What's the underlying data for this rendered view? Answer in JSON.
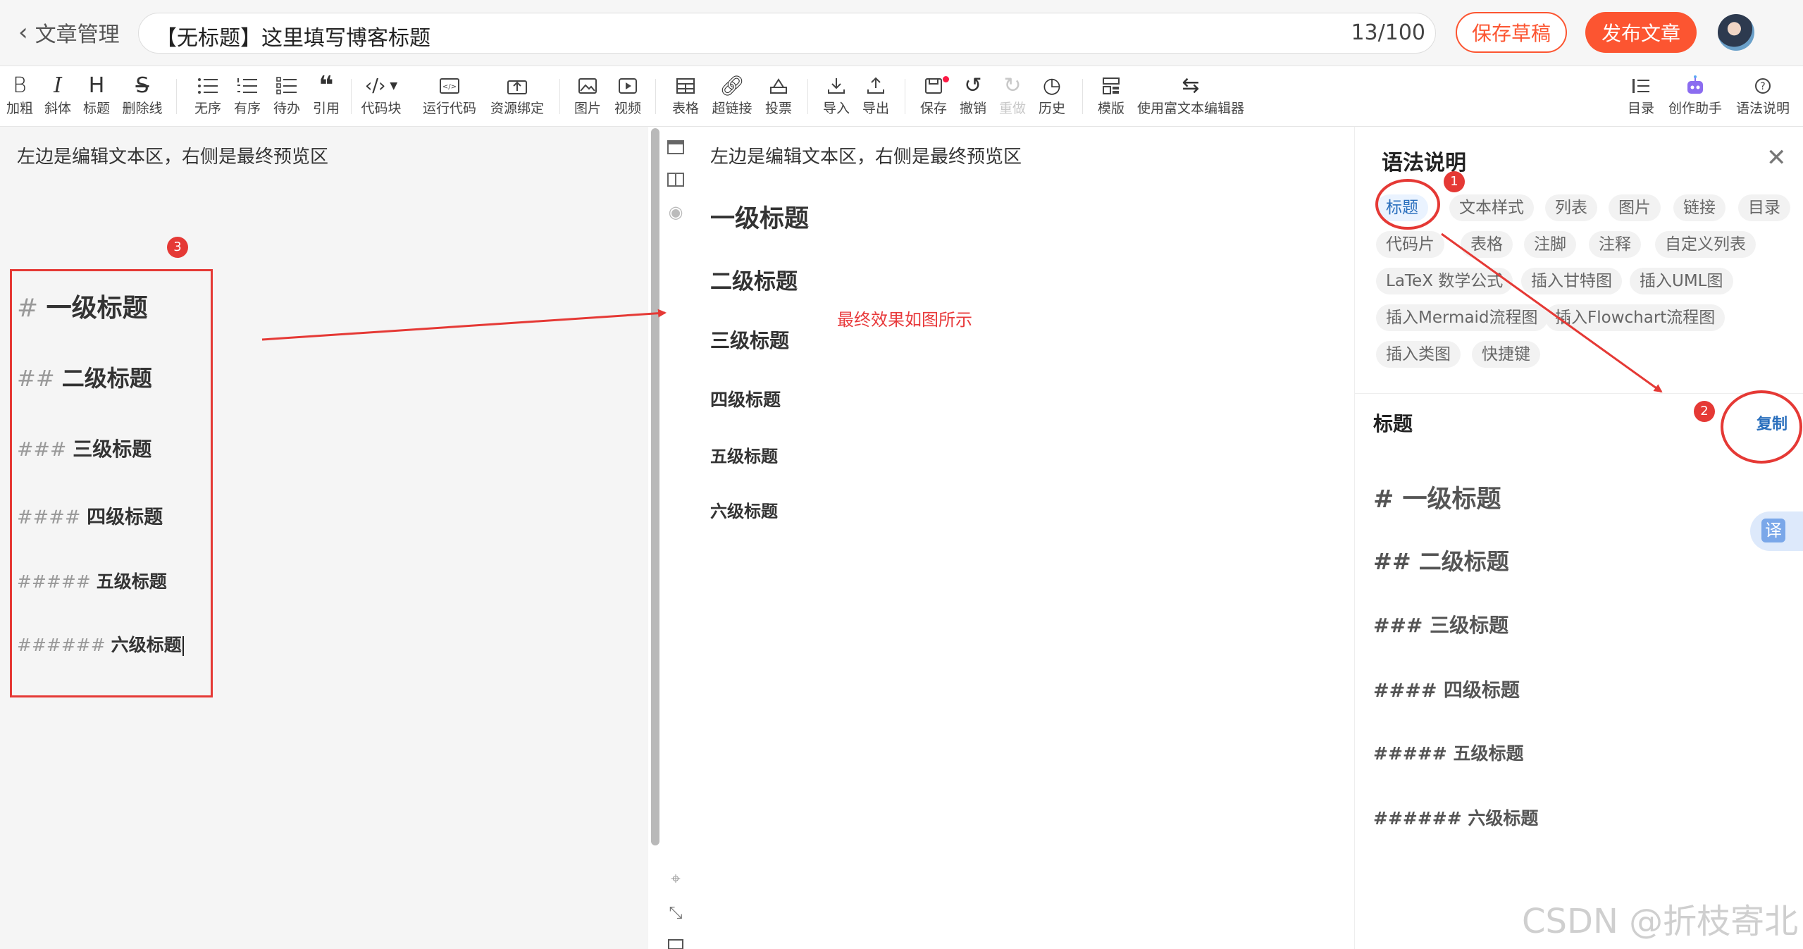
{
  "header": {
    "back_label": "文章管理",
    "title_value": "【无标题】这里填写博客标题",
    "title_count": "13/100",
    "save_draft": "保存草稿",
    "publish": "发布文章"
  },
  "toolbar": {
    "bold": "加粗",
    "italic": "斜体",
    "heading": "标题",
    "strike": "删除线",
    "ul": "无序",
    "ol": "有序",
    "todo": "待办",
    "quote": "引用",
    "codeblock": "代码块",
    "runcode": "运行代码",
    "resource": "资源绑定",
    "image": "图片",
    "video": "视频",
    "table": "表格",
    "link": "超链接",
    "vote": "投票",
    "import": "导入",
    "export": "导出",
    "save": "保存",
    "undo": "撤销",
    "redo": "重做",
    "history": "历史",
    "template": "模版",
    "richtext": "使用富文本编辑器",
    "toc": "目录",
    "assistant": "创作助手",
    "syntax": "语法说明"
  },
  "editor": {
    "intro": "左边是编辑文本区，右侧是最终预览区",
    "lines": [
      {
        "hash": "#",
        "text": "一级标题"
      },
      {
        "hash": "##",
        "text": "二级标题"
      },
      {
        "hash": "###",
        "text": "三级标题"
      },
      {
        "hash": "####",
        "text": "四级标题"
      },
      {
        "hash": "#####",
        "text": "五级标题"
      },
      {
        "hash": "######",
        "text": "六级标题"
      }
    ]
  },
  "preview": {
    "intro": "左边是编辑文本区，右侧是最终预览区",
    "headings": [
      "一级标题",
      "二级标题",
      "三级标题",
      "四级标题",
      "五级标题",
      "六级标题"
    ],
    "annotation": "最终效果如图所示"
  },
  "panel": {
    "title": "语法说明",
    "chips": [
      "标题",
      "文本样式",
      "列表",
      "图片",
      "链接",
      "目录",
      "代码片",
      "表格",
      "注脚",
      "注释",
      "自定义列表",
      "LaTeX 数学公式",
      "插入甘特图",
      "插入UML图",
      "插入Mermaid流程图",
      "插入Flowchart流程图",
      "插入类图",
      "快捷键"
    ],
    "section_title": "标题",
    "copy": "复制",
    "examples": [
      "# 一级标题",
      "## 二级标题",
      "### 三级标题",
      "#### 四级标题",
      "##### 五级标题",
      "###### 六级标题"
    ]
  },
  "badges": [
    "1",
    "2",
    "3"
  ],
  "translate_label": "译",
  "watermark": "CSDN @折枝寄北",
  "colors": {
    "brand": "#fc5531",
    "annotation": "#e53935",
    "link": "#2a6fbd"
  }
}
